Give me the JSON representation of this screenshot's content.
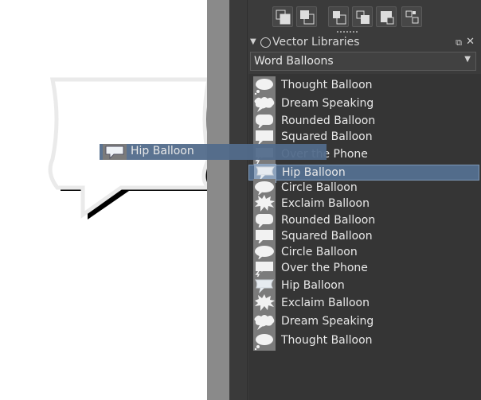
{
  "panel": {
    "title": "Vector Libraries",
    "library_selected": "Word Balloons"
  },
  "toolbar": {
    "buttons": [
      {
        "icon": "bring-to-front-icon"
      },
      {
        "icon": "send-to-back-icon"
      },
      {
        "icon": "raise-icon"
      },
      {
        "icon": "lower-icon"
      },
      {
        "icon": "group-icon"
      },
      {
        "icon": "ungroup-icon"
      }
    ]
  },
  "items": [
    {
      "label": "Thought Balloon",
      "icon": "thought-balloon-icon",
      "selected": false
    },
    {
      "label": "Dream Speaking",
      "icon": "dream-balloon-icon",
      "selected": false
    },
    {
      "label": "Rounded Balloon",
      "icon": "rounded-balloon-icon",
      "selected": false
    },
    {
      "label": "Squared Balloon",
      "icon": "squared-balloon-icon",
      "selected": false
    },
    {
      "label": "Over the Phone",
      "icon": "phone-balloon-icon",
      "selected": false
    },
    {
      "label": "Hip Balloon",
      "icon": "hip-balloon-icon",
      "selected": true
    },
    {
      "label": "Circle Balloon",
      "icon": "circle-balloon-icon",
      "selected": false
    },
    {
      "label": "Exclaim Balloon",
      "icon": "exclaim-balloon-icon",
      "selected": false
    },
    {
      "label": "Rounded Balloon",
      "icon": "rounded-balloon-icon",
      "selected": false
    },
    {
      "label": "Squared Balloon",
      "icon": "squared-balloon-icon",
      "selected": false
    },
    {
      "label": "Circle Balloon",
      "icon": "circle-balloon-icon",
      "selected": false
    },
    {
      "label": "Over the Phone",
      "icon": "phone-balloon-icon",
      "selected": false
    },
    {
      "label": "Hip Balloon",
      "icon": "hip-balloon-icon",
      "selected": false
    },
    {
      "label": "Exclaim Balloon",
      "icon": "exclaim-balloon-icon",
      "selected": false
    },
    {
      "label": "Dream Speaking",
      "icon": "dream-balloon-icon",
      "selected": false
    },
    {
      "label": "Thought Balloon",
      "icon": "thought-balloon-icon",
      "selected": false
    }
  ],
  "drag": {
    "label": "Hip Balloon",
    "icon": "hip-balloon-icon"
  }
}
